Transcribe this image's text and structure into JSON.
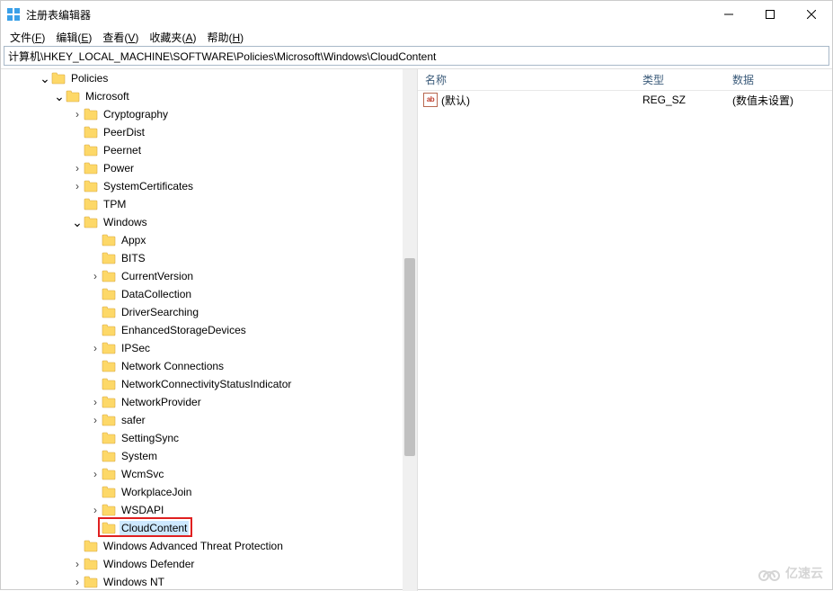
{
  "title": "注册表编辑器",
  "menus": {
    "file": {
      "base": "文件",
      "hot": "F"
    },
    "edit": {
      "base": "编辑",
      "hot": "E"
    },
    "view": {
      "base": "查看",
      "hot": "V"
    },
    "fav": {
      "base": "收藏夹",
      "hot": "A"
    },
    "help": {
      "base": "帮助",
      "hot": "H"
    }
  },
  "address": "计算机\\HKEY_LOCAL_MACHINE\\SOFTWARE\\Policies\\Microsoft\\Windows\\CloudContent",
  "tree": {
    "open_prefix": [
      {
        "indent": 42,
        "expander": "open",
        "label": "Policies"
      },
      {
        "indent": 58,
        "expander": "open",
        "label": "Microsoft"
      }
    ],
    "microsoft_children": [
      {
        "label": "Cryptography",
        "expander": "closed"
      },
      {
        "label": "PeerDist",
        "expander": ""
      },
      {
        "label": "Peernet",
        "expander": ""
      },
      {
        "label": "Power",
        "expander": "closed"
      },
      {
        "label": "SystemCertificates",
        "expander": "closed"
      },
      {
        "label": "TPM",
        "expander": ""
      }
    ],
    "windows_node": {
      "label": "Windows",
      "expander": "open"
    },
    "windows_children": [
      {
        "label": "Appx",
        "expander": ""
      },
      {
        "label": "BITS",
        "expander": ""
      },
      {
        "label": "CurrentVersion",
        "expander": "closed"
      },
      {
        "label": "DataCollection",
        "expander": ""
      },
      {
        "label": "DriverSearching",
        "expander": ""
      },
      {
        "label": "EnhancedStorageDevices",
        "expander": ""
      },
      {
        "label": "IPSec",
        "expander": "closed"
      },
      {
        "label": "Network Connections",
        "expander": ""
      },
      {
        "label": "NetworkConnectivityStatusIndicator",
        "expander": ""
      },
      {
        "label": "NetworkProvider",
        "expander": "closed"
      },
      {
        "label": "safer",
        "expander": "closed"
      },
      {
        "label": "SettingSync",
        "expander": ""
      },
      {
        "label": "System",
        "expander": ""
      },
      {
        "label": "WcmSvc",
        "expander": "closed"
      },
      {
        "label": "WorkplaceJoin",
        "expander": ""
      },
      {
        "label": "WSDAPI",
        "expander": "closed"
      },
      {
        "label": "CloudContent",
        "expander": "",
        "selected": true,
        "highlighted": true
      }
    ],
    "microsoft_trailing": [
      {
        "label": "Windows Advanced Threat Protection",
        "expander": ""
      },
      {
        "label": "Windows Defender",
        "expander": "closed"
      },
      {
        "label": "Windows NT",
        "expander": "closed"
      }
    ]
  },
  "list": {
    "headers": {
      "name": "名称",
      "type": "类型",
      "data": "数据"
    },
    "rows": [
      {
        "icon": "ab",
        "name": "(默认)",
        "type": "REG_SZ",
        "data": "(数值未设置)"
      }
    ]
  },
  "watermark": "亿速云"
}
